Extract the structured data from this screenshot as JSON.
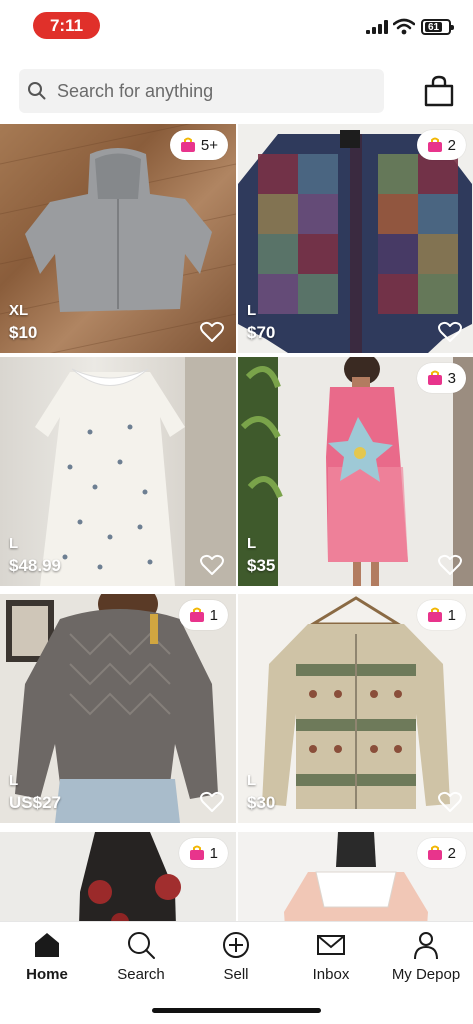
{
  "status_bar": {
    "time": "7:11",
    "battery": "61"
  },
  "search": {
    "placeholder": "Search for anything",
    "value": ""
  },
  "listings": [
    {
      "size": "XL",
      "price": "$10",
      "badge": "5+"
    },
    {
      "size": "L",
      "price": "$70",
      "badge": "2"
    },
    {
      "size": "L",
      "price": "$48.99",
      "badge": ""
    },
    {
      "size": "L",
      "price": "$35",
      "badge": "3"
    },
    {
      "size": "L",
      "price": "US$27",
      "badge": "1"
    },
    {
      "size": "L",
      "price": "$30",
      "badge": "1"
    },
    {
      "size": "",
      "price": "",
      "badge": "1"
    },
    {
      "size": "",
      "price": "",
      "badge": "2"
    }
  ],
  "tabs": [
    {
      "label": "Home",
      "icon": "home-icon",
      "active": true
    },
    {
      "label": "Search",
      "icon": "search-icon",
      "active": false
    },
    {
      "label": "Sell",
      "icon": "plus-circle-icon",
      "active": false
    },
    {
      "label": "Inbox",
      "icon": "mail-icon",
      "active": false
    },
    {
      "label": "My Depop",
      "icon": "person-icon",
      "active": false
    }
  ],
  "colors": {
    "time_pill": "#e0302a",
    "bag_badge": "#e8348c",
    "text": "#1a1a1a"
  }
}
